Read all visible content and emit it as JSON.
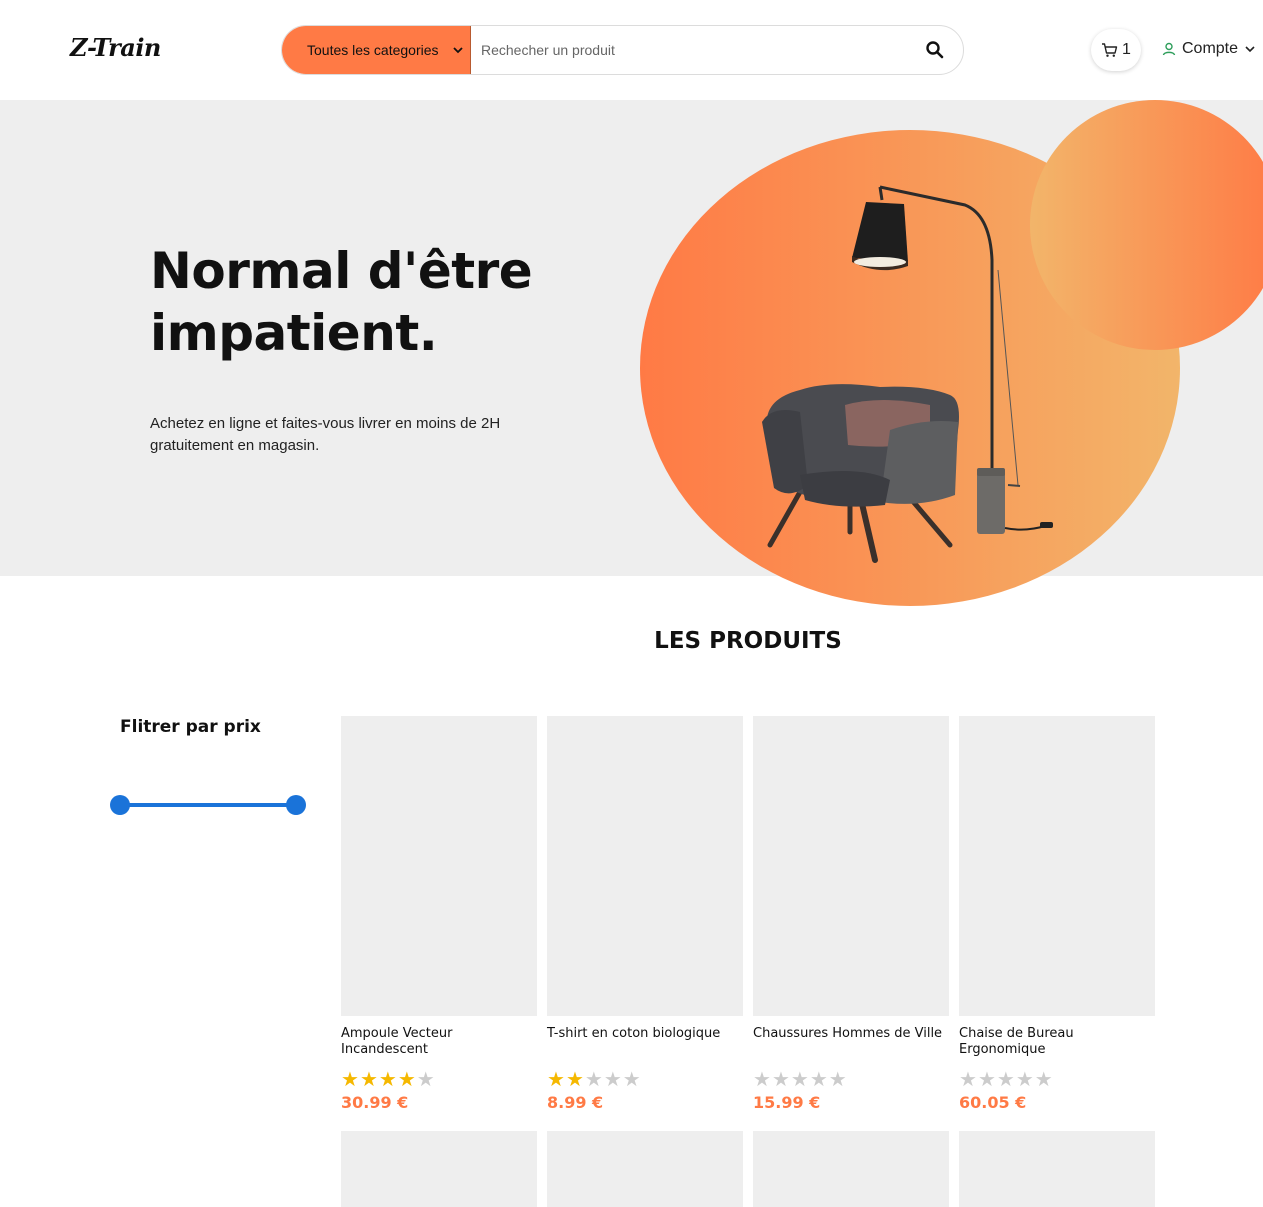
{
  "header": {
    "logo": "Z-Train",
    "category_label": "Toutes les categories",
    "search_placeholder": "Rechecher un produit",
    "cart_count": "1",
    "account_label": "Compte"
  },
  "hero": {
    "title": "Normal d'être impatient.",
    "subtitle": "Achetez en ligne et faites-vous livrer en moins de 2H gratuitement en magasin."
  },
  "products_section": {
    "title": "LES PRODUITS",
    "filter_title": "Flitrer par prix",
    "products": [
      {
        "name": "Ampoule Vecteur Incandescent",
        "rating": 4,
        "price": "30.99 €"
      },
      {
        "name": "T-shirt en coton biologique",
        "rating": 2,
        "price": "8.99 €"
      },
      {
        "name": "Chaussures Hommes de Ville",
        "rating": 0,
        "price": "15.99 €"
      },
      {
        "name": "Chaise de Bureau Ergonomique",
        "rating": 0,
        "price": "60.05 €"
      }
    ]
  },
  "colors": {
    "accent": "#ff7a45",
    "slider": "#1a73d9",
    "star_on": "#f5b800",
    "star_off": "#cccccc",
    "placeholder_bg": "#eeeeee"
  }
}
